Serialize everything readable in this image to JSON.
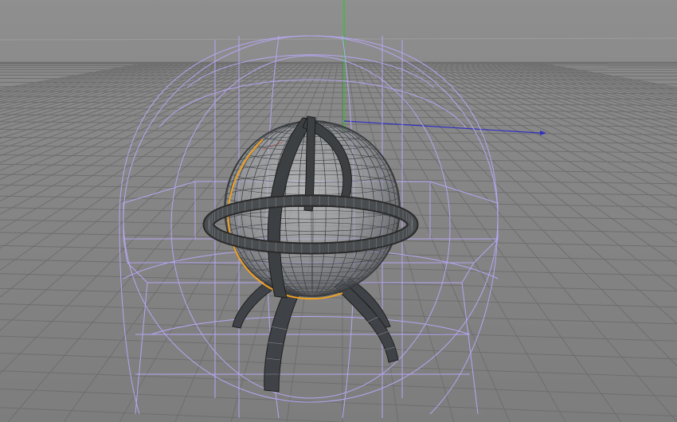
{
  "viewport": {
    "background_color": "#8b8b8b",
    "grid_color": "#6f6f6f",
    "horizon_color": "#9a9a9a",
    "cage_color": "#b7a8f0",
    "mesh_color": "#3a3a3a",
    "mesh_fill": "#9fa3a7",
    "ring_color": "#2b2b2b",
    "highlight_color": "#f0a020",
    "axis_y_color": "#22cc22",
    "axis_x_color": "#3030c0",
    "axis_z_color": "#c02020"
  },
  "scene": {
    "object": "globe-model",
    "display_mode": "wireframe-overlay",
    "parts": [
      "sphere",
      "equator-ring",
      "meridian-arcs",
      "stand-legs",
      "cage-deformer"
    ]
  }
}
